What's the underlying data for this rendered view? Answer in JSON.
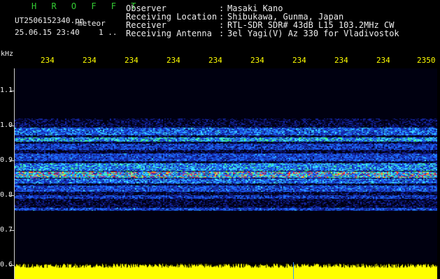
{
  "header": {
    "brand": "H R O F F T",
    "filename": "UT2506152340.pn",
    "mode_label": "meteor",
    "datetime": "25.06.15 23:40",
    "count": "1 ..",
    "meta": [
      {
        "key": "Observer",
        "value": "Masaki Kano"
      },
      {
        "key": "Receiving Location",
        "value": "Shibukawa, Gunma, Japan"
      },
      {
        "key": "Receiver",
        "value": "RTL-SDR SDR# 43dB L15 103.2MHz CW"
      },
      {
        "key": "Receiving Antenna",
        "value": "3el Yagi(V) Az 330 for Vladivostok"
      }
    ]
  },
  "axes": {
    "y_unit": "kHz",
    "x_ticks": [
      "234",
      "234",
      "234",
      "234",
      "234",
      "234",
      "234",
      "234",
      "234",
      "2350"
    ],
    "y_ticks": [
      "1.1",
      "1.0",
      "0.9",
      "0.8",
      "0.7",
      "0.6"
    ]
  },
  "colors": {
    "background": "#000000",
    "axis_text": "#eeeeee",
    "time_tick_text": "#ffff00",
    "brand": "#33cc33",
    "amplitude": "#ffff00",
    "marker": "#3399ff"
  }
}
